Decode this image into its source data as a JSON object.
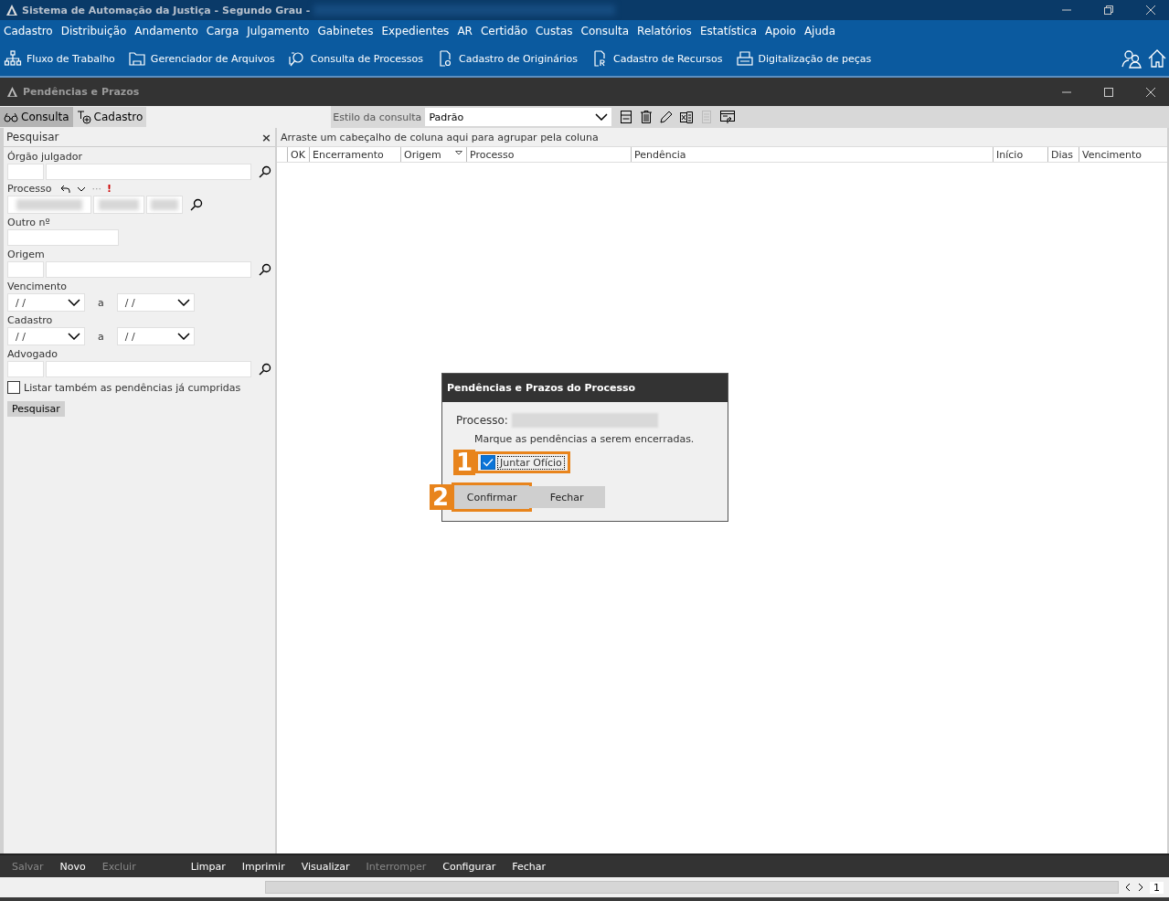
{
  "window": {
    "title": "Sistema de Automação da Justiça - Segundo Grau -",
    "title_redacted": true
  },
  "menu": [
    "Cadastro",
    "Distribuição",
    "Andamento",
    "Carga",
    "Julgamento",
    "Gabinetes",
    "Expedientes",
    "AR",
    "Certidão",
    "Custas",
    "Consulta",
    "Relatórios",
    "Estatística",
    "Apoio",
    "Ajuda"
  ],
  "toolbar": [
    {
      "kind": "flow",
      "label": "Fluxo de Trabalho"
    },
    {
      "kind": "folder",
      "label": "Gerenciador de Arquivos"
    },
    {
      "kind": "search",
      "label": "Consulta de Processos"
    },
    {
      "kind": "doc-o",
      "label": "Cadastro de Originários"
    },
    {
      "kind": "doc-r",
      "label": "Cadastro de Recursos"
    },
    {
      "kind": "scanner",
      "label": "Digitalização de peças"
    }
  ],
  "inner_window": {
    "title": "Pendências e Prazos"
  },
  "tabs": [
    {
      "label": "Consulta",
      "kind": "binoculars",
      "selected": true
    },
    {
      "label": "Cadastro",
      "kind": "add",
      "selected": false
    }
  ],
  "style_select": {
    "label": "Estilo da consulta",
    "value": "Padrão"
  },
  "search_panel": {
    "title": "Pesquisar",
    "close": "×",
    "fields": [
      {
        "label": "Órgão julgador",
        "kind": "pair-search"
      },
      {
        "label": "Processo",
        "kind": "process"
      },
      {
        "label": "Outro nº",
        "kind": "single"
      },
      {
        "label": "Origem",
        "kind": "pair-search"
      },
      {
        "label": "Vencimento",
        "kind": "date-range",
        "from": "/ /",
        "sep": "a",
        "to": "/ /"
      },
      {
        "label": "Cadastro",
        "kind": "date-range",
        "from": "/ /",
        "sep": "a",
        "to": "/ /"
      },
      {
        "label": "Advogado",
        "kind": "pair-search"
      }
    ],
    "process_more": "···",
    "process_alert": "!",
    "option": {
      "label": "Listar também as pendências já cumpridas",
      "checked": false
    },
    "button": "Pesquisar"
  },
  "grid": {
    "group_hint": "Arraste um cabeçalho de coluna aqui para agrupar pela coluna",
    "columns": [
      "OK",
      "Encerramento",
      "Origem",
      "Processo",
      "Pendência",
      "Início",
      "Dias",
      "Vencimento"
    ]
  },
  "dialog": {
    "title": "Pendências e Prazos do Processo",
    "process_label": "Processo:",
    "process_redacted": true,
    "message": "Marque as pendências a serem encerradas.",
    "items": [
      {
        "label": "Juntar Ofício",
        "checked": true
      }
    ],
    "buttons": [
      {
        "label": "Confirmar",
        "default": true
      },
      {
        "label": "Fechar",
        "default": false
      }
    ],
    "annotations": [
      "1",
      "2"
    ]
  },
  "footer": [
    {
      "label": "Salvar",
      "disabled": true
    },
    {
      "label": "Novo",
      "disabled": false
    },
    {
      "label": "Excluir",
      "disabled": true
    },
    {
      "label": "Limpar",
      "disabled": false
    },
    {
      "label": "Imprimir",
      "disabled": false
    },
    {
      "label": "Visualizar",
      "disabled": false
    },
    {
      "label": "Interromper",
      "disabled": true
    },
    {
      "label": "Configurar",
      "disabled": false
    },
    {
      "label": "Fechar",
      "disabled": false
    }
  ],
  "pager": {
    "page": "1"
  }
}
